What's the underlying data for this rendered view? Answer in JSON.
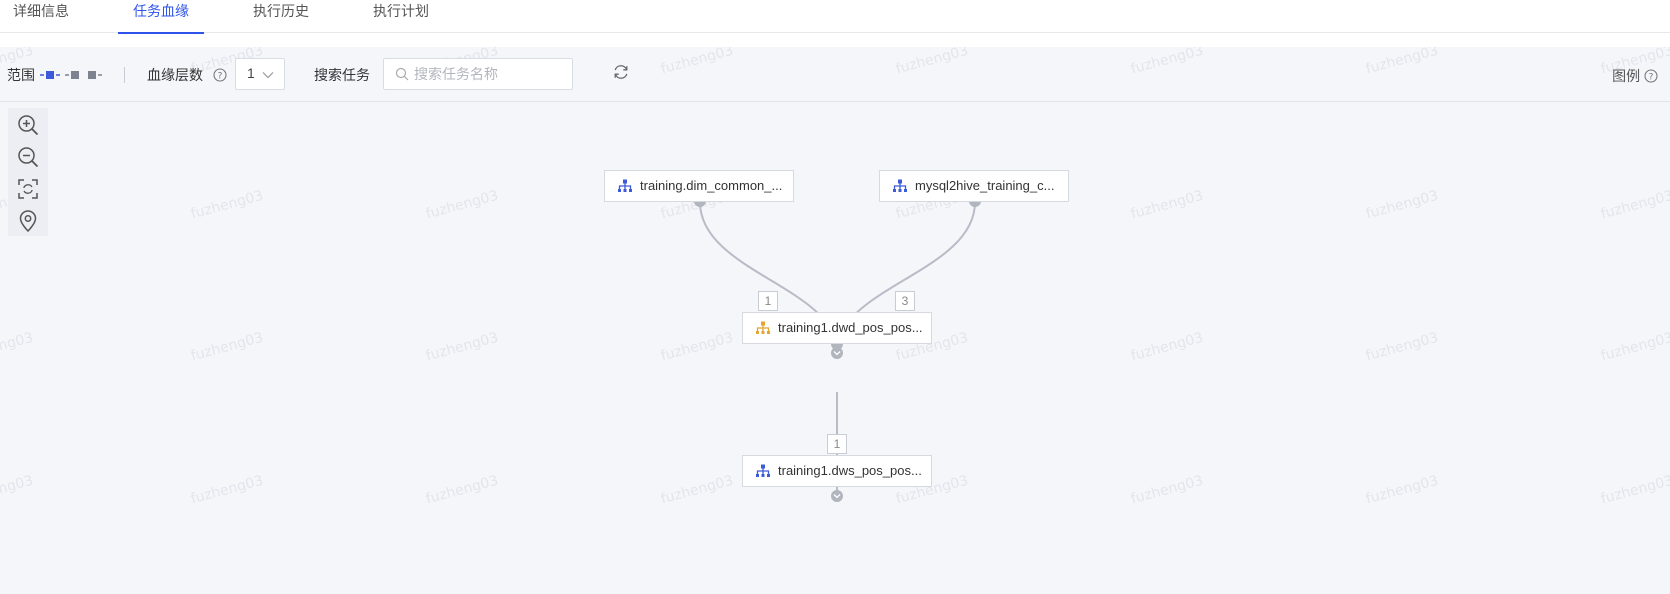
{
  "tabs": [
    {
      "label": "详细信息",
      "active": false
    },
    {
      "label": "任务血缘",
      "active": true
    },
    {
      "label": "执行历史",
      "active": false
    },
    {
      "label": "执行计划",
      "active": false
    }
  ],
  "toolbar": {
    "scope_label": "范围",
    "depth_label": "血缘层数",
    "depth_value": "1",
    "search_label": "搜索任务",
    "search_placeholder": "搜索任务名称",
    "search_value": "",
    "legend_label": "图例"
  },
  "zoom_tools": [
    "zoom-in-icon",
    "zoom-out-icon",
    "fit-view-icon",
    "locate-icon"
  ],
  "watermark_text": "fuzheng03",
  "graph": {
    "nodes": [
      {
        "id": "n1",
        "label": "training.dim_common_...",
        "icon_color": "#3d5bd9"
      },
      {
        "id": "n2",
        "label": "mysql2hive_training_c...",
        "icon_color": "#3d5bd9"
      },
      {
        "id": "n3",
        "label": "training1.dwd_pos_pos...",
        "icon_color": "#e8a431"
      },
      {
        "id": "n4",
        "label": "training1.dws_pos_pos...",
        "icon_color": "#3d5bd9"
      }
    ],
    "edges": [
      {
        "from": "n1",
        "to": "n3",
        "label": "1"
      },
      {
        "from": "n2",
        "to": "n3",
        "label": "3"
      },
      {
        "from": "n3",
        "to": "n4",
        "label": "1"
      }
    ]
  },
  "colors": {
    "accent": "#2f54eb",
    "edge": "#b8bcc6",
    "canvas_bg": "#f5f6fa"
  }
}
